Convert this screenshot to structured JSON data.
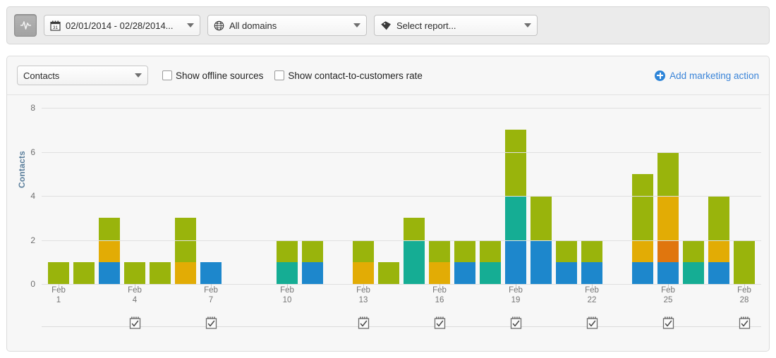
{
  "toolbar": {
    "activity_button": {
      "icon": "activity-pulse-icon"
    },
    "date_range": {
      "icon": "calendar-icon",
      "value": "02/01/2014 - 02/28/2014..."
    },
    "domain": {
      "icon": "globe-icon",
      "value": "All domains"
    },
    "report": {
      "icon": "tag-icon",
      "value": "Select report..."
    }
  },
  "controls": {
    "metric": {
      "value": "Contacts"
    },
    "checkboxes": [
      {
        "label": "Show offline sources",
        "checked": false
      },
      {
        "label": "Show contact-to-customers rate",
        "checked": false
      }
    ],
    "add_action": {
      "label": "Add marketing action",
      "icon": "plus-circle-icon",
      "color": "#3a84d8"
    }
  },
  "chart_data": {
    "type": "bar",
    "title": "",
    "xlabel": "",
    "ylabel": "Contacts",
    "ylim": [
      0,
      8
    ],
    "yticks": [
      0,
      2,
      4,
      6,
      8
    ],
    "grid": true,
    "stacked": true,
    "legend": "none",
    "colors": {
      "blue": "#1d87cc",
      "teal": "#15ad94",
      "orange": "#e2ac05",
      "dark_orange": "#e0760e",
      "green": "#99b40c"
    },
    "categories": [
      "Feb 1",
      "Feb 2",
      "Feb 3",
      "Feb 4",
      "Feb 5",
      "Feb 6",
      "Feb 7",
      "Feb 8",
      "Feb 9",
      "Feb 10",
      "Feb 11",
      "Feb 12",
      "Feb 13",
      "Feb 14",
      "Feb 15",
      "Feb 16",
      "Feb 17",
      "Feb 18",
      "Feb 19",
      "Feb 20",
      "Feb 21",
      "Feb 22",
      "Feb 23",
      "Feb 24",
      "Feb 25",
      "Feb 26",
      "Feb 27",
      "Feb 28"
    ],
    "tick_labels": [
      {
        "index": 0,
        "month": "Feb",
        "day": "1"
      },
      {
        "index": 3,
        "month": "Feb",
        "day": "4"
      },
      {
        "index": 6,
        "month": "Feb",
        "day": "7"
      },
      {
        "index": 9,
        "month": "Feb",
        "day": "10"
      },
      {
        "index": 12,
        "month": "Feb",
        "day": "13"
      },
      {
        "index": 15,
        "month": "Feb",
        "day": "16"
      },
      {
        "index": 18,
        "month": "Feb",
        "day": "19"
      },
      {
        "index": 21,
        "month": "Feb",
        "day": "22"
      },
      {
        "index": 24,
        "month": "Feb",
        "day": "25"
      },
      {
        "index": 27,
        "month": "Feb",
        "day": "28"
      }
    ],
    "series": [
      {
        "name": "blue",
        "color": "#1d87cc",
        "values": [
          0,
          0,
          1,
          0,
          0,
          0,
          1,
          0,
          0,
          0,
          1,
          0,
          0,
          0,
          0,
          0,
          1,
          0,
          2,
          2,
          1,
          1,
          0,
          1,
          1,
          0,
          1,
          0
        ]
      },
      {
        "name": "teal",
        "color": "#15ad94",
        "values": [
          0,
          0,
          0,
          0,
          0,
          0,
          0,
          0,
          0,
          1,
          0,
          0,
          0,
          0,
          2,
          0,
          0,
          1,
          2,
          0,
          0,
          0,
          0,
          0,
          0,
          1,
          0,
          0
        ]
      },
      {
        "name": "dark_orange",
        "color": "#e0760e",
        "values": [
          0,
          0,
          0,
          0,
          0,
          0,
          0,
          0,
          0,
          0,
          0,
          0,
          0,
          0,
          0,
          0,
          0,
          0,
          0,
          0,
          0,
          0,
          0,
          0,
          1,
          0,
          0,
          0
        ]
      },
      {
        "name": "orange",
        "color": "#e2ac05",
        "values": [
          0,
          0,
          1,
          0,
          0,
          1,
          0,
          0,
          0,
          0,
          0,
          0,
          1,
          0,
          0,
          1,
          0,
          0,
          0,
          0,
          0,
          0,
          0,
          1,
          2,
          0,
          1,
          0
        ]
      },
      {
        "name": "green",
        "color": "#99b40c",
        "values": [
          1,
          1,
          1,
          1,
          1,
          2,
          0,
          0,
          0,
          1,
          1,
          0,
          1,
          1,
          1,
          1,
          1,
          1,
          3,
          2,
          1,
          1,
          0,
          3,
          2,
          1,
          2,
          2
        ]
      }
    ],
    "totals": [
      1,
      1,
      3,
      1,
      1,
      3,
      1,
      0,
      0,
      2,
      2,
      0,
      2,
      1,
      3,
      2,
      2,
      2,
      7,
      4,
      2,
      2,
      0,
      5,
      6,
      2,
      4,
      2
    ],
    "marketing_action_markers": [
      3,
      6,
      12,
      15,
      18,
      21,
      24,
      27
    ]
  }
}
